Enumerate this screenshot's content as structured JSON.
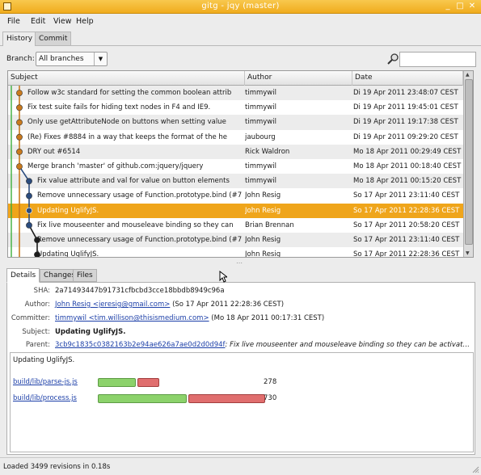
{
  "window": {
    "title": "gitg - jqy (master)"
  },
  "menu": [
    "File",
    "Edit",
    "View",
    "Help"
  ],
  "view_tabs": [
    "History",
    "Commit"
  ],
  "branch": {
    "label": "Branch:",
    "value": "All branches"
  },
  "columns": {
    "subject": "Subject",
    "author": "Author",
    "date": "Date"
  },
  "commits": [
    {
      "subject": "Follow w3c standard for setting the common boolean attrib",
      "author": "timmywil",
      "date": "Di 19 Apr 2011 23:48:07 CEST",
      "lane": 0
    },
    {
      "subject": "Fix test suite fails for hiding text nodes in F4 and IE9.",
      "author": "timmywil",
      "date": "Di 19 Apr 2011 19:45:01 CEST",
      "lane": 0
    },
    {
      "subject": "Only use getAttributeNode on buttons when setting value",
      "author": "timmywil",
      "date": "Di 19 Apr 2011 19:17:38 CEST",
      "lane": 0
    },
    {
      "subject": "(Re) Fixes #8884 in a way that keeps the format of the he",
      "author": "jaubourg",
      "date": "Di 19 Apr 2011 09:29:20 CEST",
      "lane": 0
    },
    {
      "subject": "DRY out #6514",
      "author": "Rick Waldron",
      "date": "Mo 18 Apr 2011 00:29:49 CEST",
      "lane": 0
    },
    {
      "subject": "Merge branch 'master' of github.com:jquery/jquery",
      "author": "timmywil",
      "date": "Mo 18 Apr 2011 00:18:40 CEST",
      "lane": 0
    },
    {
      "subject": "Fix value attribute and val for value on button elements",
      "author": "timmywil",
      "date": "Mo 18 Apr 2011 00:15:20 CEST",
      "lane": 1
    },
    {
      "subject": "Remove unnecessary usage of Function.prototype.bind (#7",
      "author": "John Resig",
      "date": "So 17 Apr 2011 23:11:40 CEST",
      "lane": 1
    },
    {
      "subject": "Updating UglifyJS.",
      "author": "John Resig",
      "date": "So 17 Apr 2011 22:28:36 CEST",
      "lane": 1
    },
    {
      "subject": "Fix live mouseenter and mouseleave binding so they can",
      "author": "Brian Brennan",
      "date": "So 17 Apr 2011 20:58:20 CEST",
      "lane": 1
    },
    {
      "subject": "Remove unnecessary usage of Function.prototype.bind (#7",
      "author": "John Resig",
      "date": "So 17 Apr 2011 23:11:40 CEST",
      "lane": 2
    },
    {
      "subject": "Updating UglifyJS.",
      "author": "John Resig",
      "date": "So 17 Apr 2011 22:28:36 CEST",
      "lane": 2
    }
  ],
  "selected_index": 8,
  "detail_tabs": [
    "Details",
    "Changes",
    "Files"
  ],
  "details": {
    "sha_label": "SHA:",
    "sha": "2a71493447b91731cfbcbd3cce18bbdb8949c96a",
    "author_label": "Author:",
    "author_link": "John Resig <jeresig@gmail.com>",
    "author_date": "(So 17 Apr 2011 22:28:36 CEST)",
    "committer_label": "Committer:",
    "committer_link": "timmywil <tim.willison@thisismedium.com>",
    "committer_date": "(Mo 18 Apr 2011 00:17:31 CEST)",
    "subject_label": "Subject:",
    "subject": "Updating UglifyJS.",
    "parent_label": "Parent:",
    "parent_link": "3cb9c1835c0382163b2e94ae626a7ae0d2d0d94f",
    "parent_msg": ": Fix live mouseenter and mouseleave binding so they can be activat…",
    "message": "Updating UglifyJS."
  },
  "files": [
    {
      "path": "build/lib/parse-js.js",
      "count": "278",
      "added": 278,
      "removed": 160
    },
    {
      "path": "build/lib/process.js",
      "count": "730",
      "added": 648,
      "removed": 555
    }
  ],
  "status": "Loaded 3499 revisions in 0.18s",
  "colors": {
    "selection": "#efa51b",
    "lane_master": "#c97a1e",
    "lane_branch": "#2b4c7e",
    "lane_third": "#1c1c1c",
    "added": "#8cd26b",
    "removed": "#e06e6e"
  }
}
